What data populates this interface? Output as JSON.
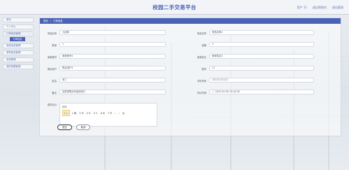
{
  "header": {
    "title": "校园二手交易平台",
    "user_label": "用户 11",
    "back_home": "退出到前台",
    "logout": "退出登录"
  },
  "sidebar": {
    "items": [
      {
        "label": "首页"
      },
      {
        "label": "个人中心"
      },
      {
        "label": "订单信息管理"
      },
      {
        "label": "商品信息管理"
      },
      {
        "label": "求购信息管理"
      },
      {
        "label": "系统管理"
      },
      {
        "label": "我的收藏管理"
      }
    ],
    "active_sub": "订单信息"
  },
  "breadcrumb": {
    "home": "首页",
    "sep": "/",
    "current": "订单信息"
  },
  "form": {
    "left": [
      {
        "label": "商品名称",
        "value": "九成新"
      },
      {
        "label": "数量",
        "value": "1"
      },
      {
        "label": "卖家账号",
        "value": "卖家账号4"
      },
      {
        "label": "购买用户",
        "value": "购买用户4"
      },
      {
        "label": "姓名",
        "value": "张三"
      },
      {
        "label": "备注",
        "value": "这是是购买商品的地方"
      }
    ],
    "right": [
      {
        "label": "商品名称",
        "value": "商品名称4"
      },
      {
        "label": "金额",
        "value": "4"
      },
      {
        "label": "卖家姓名",
        "value": "卖家姓名4"
      },
      {
        "label": "账号",
        "value": "11"
      },
      {
        "label": "手机号码",
        "value": "13111111111"
      },
      {
        "label": "评价时间",
        "value": "2022-03-09 10:10:26"
      }
    ],
    "review_label": "收货评价",
    "review_value": "好评",
    "toolbar": [
      "1 ⓘ",
      "2 着",
      "3 ☰",
      "4 ⊡",
      "5 ✎",
      "6 ⊞",
      "7 ☰",
      "‹",
      "›",
      "☺"
    ]
  },
  "actions": {
    "submit": "提交",
    "cancel": "取消"
  }
}
